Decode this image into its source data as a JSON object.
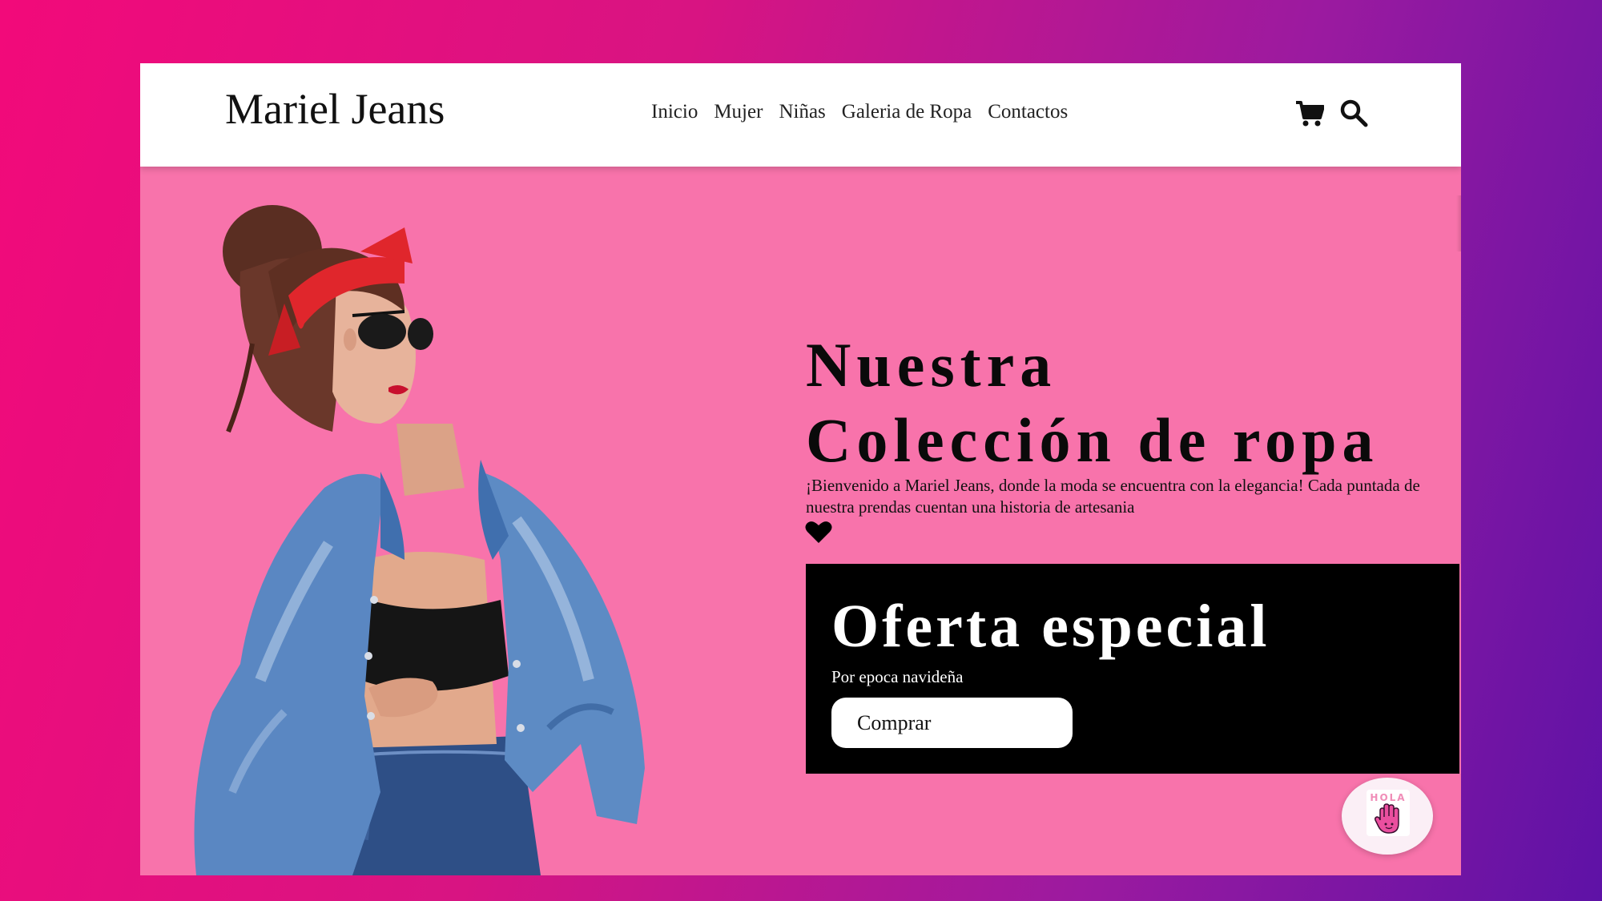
{
  "brand": {
    "name": "Mariel Jeans"
  },
  "nav": {
    "items": [
      {
        "label": "Inicio"
      },
      {
        "label": "Mujer"
      },
      {
        "label": "Niñas"
      },
      {
        "label": "Galeria de Ropa"
      },
      {
        "label": "Contactos"
      }
    ],
    "icons": [
      "cart-icon",
      "search-icon"
    ]
  },
  "hero": {
    "headline_line1": "Nuestra",
    "headline_line2": "Colección de ropa",
    "intro": "¡Bienvenido a Mariel Jeans, donde la moda se encuentra con la elegancia! Cada puntada de nuestra prendas cuentan una historia de artesania",
    "decoration_icon": "heart-icon"
  },
  "offer": {
    "title": "Oferta especial",
    "subtitle": "Por epoca navideña",
    "button_label": "Comprar"
  },
  "chat": {
    "greeting": "HOLA",
    "icon": "waving-hand-icon"
  },
  "colors": {
    "background_gradient_start": "#f20a7a",
    "background_gradient_end": "#5e12a6",
    "hero_pink": "#f873ab",
    "offer_black": "#000000",
    "navbar_white": "#ffffff"
  }
}
